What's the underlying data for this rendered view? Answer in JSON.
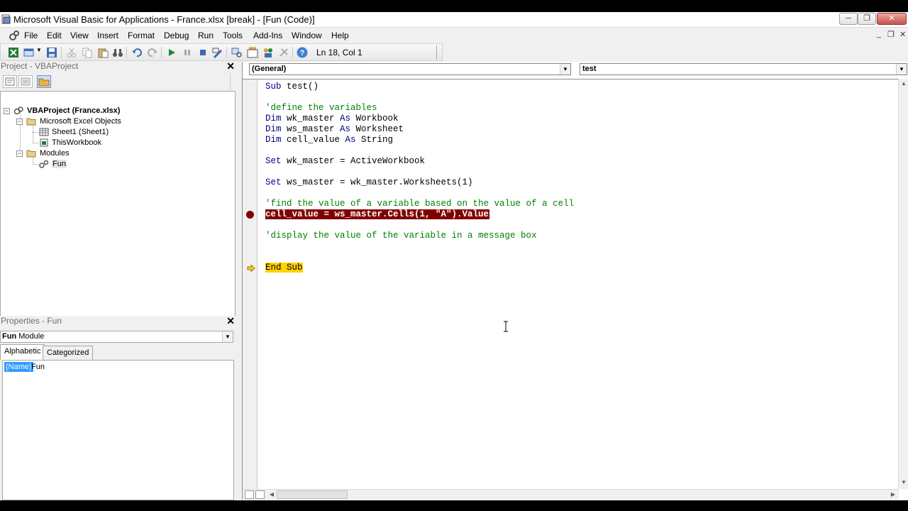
{
  "window": {
    "title": "Microsoft Visual Basic for Applications - France.xlsx [break] - [Fun (Code)]",
    "minimize": "─",
    "maximize": "❐",
    "close": "✕"
  },
  "menu": {
    "items": [
      "File",
      "Edit",
      "View",
      "Insert",
      "Format",
      "Debug",
      "Run",
      "Tools",
      "Add-Ins",
      "Window",
      "Help"
    ],
    "mdi_min": "_",
    "mdi_restore": "❐",
    "mdi_close": "✕"
  },
  "toolbar": {
    "position": "Ln 18, Col 1"
  },
  "project": {
    "title": "Project - VBAProject",
    "close": "✕",
    "root": "VBAProject (France.xlsx)",
    "folder1": "Microsoft Excel Objects",
    "sheet1": "Sheet1 (Sheet1)",
    "thisworkbook": "ThisWorkbook",
    "folder2": "Modules",
    "module": "Fun"
  },
  "properties": {
    "title": "Properties - Fun",
    "close": "✕",
    "object_name": "Fun",
    "object_type": "Module",
    "tab_alphabetic": "Alphabetic",
    "tab_categorized": "Categorized",
    "row_key": "(Name)",
    "row_value": "Fun"
  },
  "code": {
    "object_combo": "(General)",
    "proc_combo": "test",
    "lines": [
      {
        "kw": "Sub",
        "rest": " test()"
      },
      {
        "comment": "'define the variables"
      },
      {
        "kw": "Dim",
        "rest": " wk_master ",
        "kw2": "As",
        "rest2": " Workbook"
      },
      {
        "kw": "Dim",
        "rest": " ws_master ",
        "kw2": "As",
        "rest2": " Worksheet"
      },
      {
        "kw": "Dim",
        "rest": " cell_value ",
        "kw2": "As",
        "rest2": " String"
      },
      {
        "kw": "Set",
        "rest": " wk_master = ActiveWorkbook"
      },
      {
        "kw": "Set",
        "rest": " ws_master = wk_master.Worksheets(1)"
      },
      {
        "comment": "'find the value of a variable based on the value of a cell"
      },
      {
        "breakpoint": "cell_value = ws_master.Cells(1, \"A\").Value"
      },
      {
        "comment": "'display the value of the variable in a message box"
      },
      {
        "exec": "End Sub"
      }
    ]
  },
  "colors": {
    "keyword": "#00007f",
    "comment": "#007f00",
    "breakpoint": "#800000",
    "exec_highlight": "#ffd200",
    "selection": "#3399ff"
  }
}
